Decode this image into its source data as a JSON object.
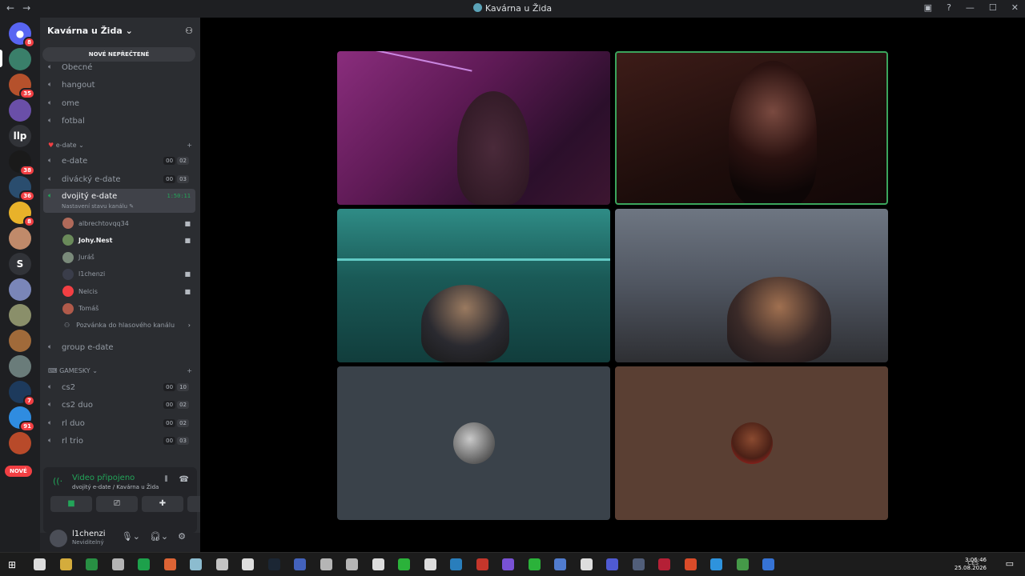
{
  "window": {
    "title": "Kavárna u Žida",
    "back_glyph": "←",
    "forward_glyph": "→",
    "controls": [
      "▣",
      "?",
      "—",
      "☐",
      "✕"
    ]
  },
  "rail": {
    "servers": [
      {
        "icon": "discord-icon",
        "glyph": "●",
        "badge": "8",
        "color": "#5865f2"
      },
      {
        "icon": "server-avatar-1",
        "glyph": "",
        "badge": "",
        "color": "#3a7f6a"
      },
      {
        "icon": "server-avatar-2",
        "glyph": "",
        "badge": "35",
        "color": "#b5512c"
      },
      {
        "icon": "server-avatar-3",
        "glyph": "",
        "badge": "",
        "color": "#6a4fa8"
      },
      {
        "icon": "server-llp",
        "glyph": "llp",
        "badge": "",
        "color": "#313338"
      },
      {
        "icon": "server-avatar-4",
        "glyph": "",
        "badge": "38",
        "color": "#1a1a1a"
      },
      {
        "icon": "server-avatar-5",
        "glyph": "",
        "badge": "36",
        "color": "#2a4d6e"
      },
      {
        "icon": "server-avatar-6",
        "glyph": "",
        "badge": "8",
        "color": "#e8b22a"
      },
      {
        "icon": "server-avatar-7",
        "glyph": "",
        "badge": "",
        "color": "#c08a6a"
      },
      {
        "icon": "server-s",
        "glyph": "S",
        "badge": "",
        "color": "#313338"
      },
      {
        "icon": "server-avatar-8",
        "glyph": "",
        "badge": "",
        "color": "#7a86b8"
      },
      {
        "icon": "server-avatar-9",
        "glyph": "",
        "badge": "",
        "color": "#8a8f6a"
      },
      {
        "icon": "server-avatar-10",
        "glyph": "",
        "badge": "",
        "color": "#a06a3a"
      },
      {
        "icon": "server-avatar-11",
        "glyph": "",
        "badge": "",
        "color": "#6a7c7a"
      },
      {
        "icon": "server-avatar-12",
        "glyph": "",
        "badge": "7",
        "color": "#1d3a5c"
      },
      {
        "icon": "server-avatar-13",
        "glyph": "",
        "badge": "91",
        "color": "#2f8ce0"
      },
      {
        "icon": "server-avatar-14",
        "glyph": "",
        "badge": "",
        "color": "#b84a2a"
      }
    ],
    "new_pill": "NOVÉ"
  },
  "sidebar": {
    "server_name": "Kavárna u Žida",
    "unread_banner": "NOVÉ NEPŘEČTENÉ",
    "channels_top": [
      "Obecné",
      "hangout",
      "ome",
      "fotbal"
    ],
    "cat_edate": "e-date",
    "edate_channels": [
      {
        "name": "e-date",
        "c1": "00",
        "c2": "02"
      },
      {
        "name": "divácký e-date",
        "c1": "00",
        "c2": "03"
      }
    ],
    "active": {
      "name": "dvojitý e-date",
      "status": "Nastavení stavu kanálu",
      "timer": "1:50:11"
    },
    "users": [
      {
        "name": "albrechtovqq34",
        "cam": true,
        "bright": false,
        "color": "#b06a5a"
      },
      {
        "name": "Johy.Nest",
        "cam": true,
        "bright": true,
        "color": "#6a8a5a"
      },
      {
        "name": "Juráš",
        "cam": false,
        "bright": false,
        "color": "#7a8a7a"
      },
      {
        "name": "l1chenzi",
        "cam": true,
        "bright": false,
        "color": "#3a3d4a"
      },
      {
        "name": "Nelcis",
        "cam": true,
        "bright": false,
        "color": "#f23f43"
      },
      {
        "name": "Tomáš",
        "cam": false,
        "bright": false,
        "color": "#b05a4a"
      }
    ],
    "invite": "Pozvánka do hlasového kanálu",
    "group_channel": "group e-date",
    "cat_gamesky": "GAMESKY",
    "game_channels": [
      {
        "name": "cs2",
        "c1": "00",
        "c2": "10"
      },
      {
        "name": "cs2 duo",
        "c1": "00",
        "c2": "02"
      },
      {
        "name": "rl duo",
        "c1": "00",
        "c2": "02"
      },
      {
        "name": "rl trio",
        "c1": "00",
        "c2": "03"
      }
    ]
  },
  "voice": {
    "title": "Video připojeno",
    "subtitle": "dvojitý e-date / Kavárna u Žida"
  },
  "user": {
    "name": "l1chenzi",
    "status": "Neviditelný"
  },
  "stage": {
    "tiles": [
      "video-feed-1",
      "video-feed-2",
      "video-feed-3",
      "video-feed-4",
      "avatar-tile-1",
      "avatar-tile-2"
    ]
  },
  "taskbar": {
    "language": "CES",
    "time": "3:06:46",
    "date": "25.08.2026"
  }
}
